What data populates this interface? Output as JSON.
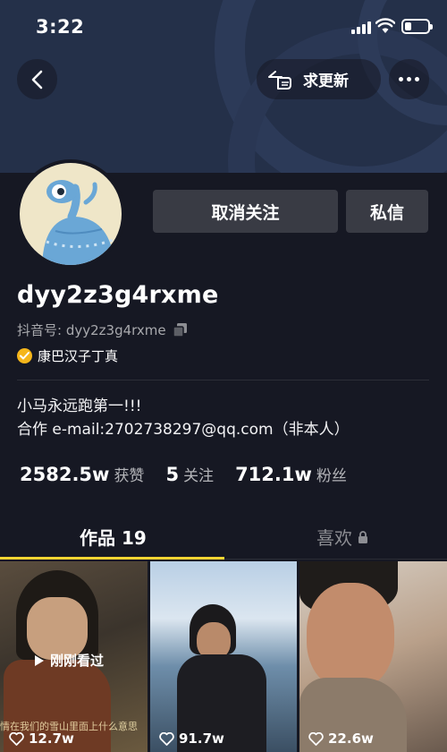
{
  "status_bar": {
    "time": "3:22"
  },
  "nav": {
    "update_label": "求更新"
  },
  "actions": {
    "unfollow_label": "取消关注",
    "message_label": "私信"
  },
  "profile": {
    "username": "dyy2z3g4rxme",
    "douyin_id_label": "抖音号:",
    "douyin_id": "dyy2z3g4rxme",
    "verified_name": "康巴汉子丁真",
    "bio_line1": "小马永远跑第一!!!",
    "bio_line2": "合作 e-mail:2702738297@qq.com（非本人）"
  },
  "stats": [
    {
      "value": "2582.5w",
      "label": "获赞"
    },
    {
      "value": "5",
      "label": "关注"
    },
    {
      "value": "712.1w",
      "label": "粉丝"
    }
  ],
  "tabs": {
    "works_label": "作品 19",
    "likes_label": "喜欢"
  },
  "videos": [
    {
      "likes": "12.7w",
      "badge": "刚刚看过",
      "caption": "情在我们的雪山里面上什么意思"
    },
    {
      "likes": "91.7w"
    },
    {
      "likes": "22.6w"
    }
  ],
  "colors": {
    "background": "#161823",
    "accent": "#fbd532",
    "verified": "#f5b61b",
    "button": "#393b44"
  },
  "icons": [
    "back-icon",
    "hand-pointer-icon",
    "more-icon",
    "copy-icon",
    "verified-icon",
    "lock-icon",
    "heart-icon",
    "play-icon"
  ]
}
